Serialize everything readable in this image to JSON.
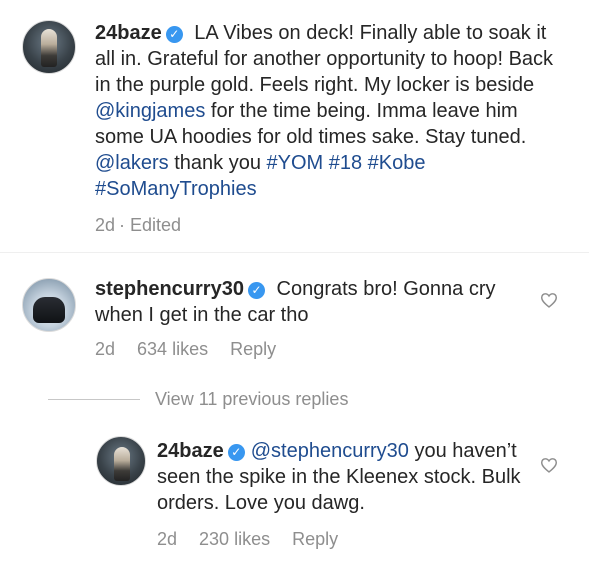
{
  "post": {
    "username": "24baze",
    "caption_parts": [
      {
        "text": " LA Vibes on deck! Finally able to soak it all in. Grateful for another opportunity to hoop! Back in the purple gold. Feels right. My locker is beside ",
        "type": "text"
      },
      {
        "text": "@kingjames",
        "type": "link"
      },
      {
        "text": " for the time being. Imma leave him some UA hoodies for old times sake. Stay tuned. ",
        "type": "text"
      },
      {
        "text": "@lakers",
        "type": "link"
      },
      {
        "text": " thank you ",
        "type": "text"
      },
      {
        "text": "#YOM #18 #Kobe #SoManyTrophies",
        "type": "link"
      }
    ],
    "time": "2d",
    "edited": "· Edited"
  },
  "comment1": {
    "username": "stephencurry30",
    "text": " Congrats bro! Gonna cry when I get in the car tho",
    "time": "2d",
    "likes": "634 likes",
    "reply": "Reply"
  },
  "view_replies": "View 11 previous replies",
  "reply1": {
    "username": "24baze",
    "mention": "@stephencurry30",
    "text": " you haven’t seen the spike in the Kleenex stock. Bulk orders. Love you dawg.",
    "time": "2d",
    "likes": "230 likes",
    "reply": "Reply"
  },
  "icons": {
    "verified": "verified-badge-icon",
    "like": "heart-outline-icon"
  },
  "colors": {
    "text": "#262626",
    "link": "#1f4c8f",
    "meta": "#8e8e8e",
    "verified": "#3897f0"
  }
}
